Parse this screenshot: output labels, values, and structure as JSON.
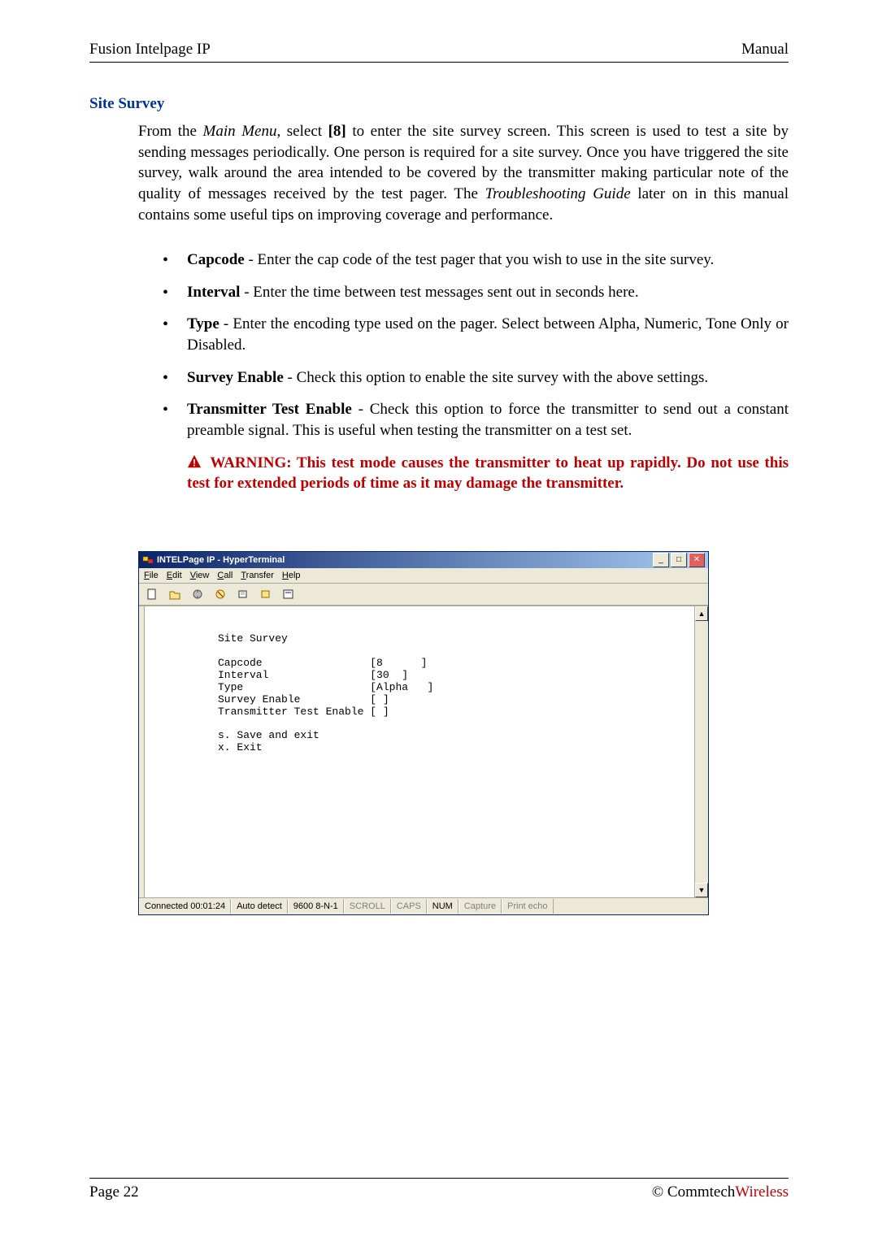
{
  "header": {
    "left": "Fusion Intelpage IP",
    "right": "Manual"
  },
  "section": {
    "title": "Site Survey",
    "intro_parts": {
      "pre_italic1": "From the ",
      "italic1": "Main Menu",
      "mid1": ", select ",
      "bold1": "[8]",
      "mid2": " to enter the site survey screen. This screen is used to test a site by sending messages periodically. One person is required for a site survey. Once you have triggered the site survey, walk around the area intended to be covered by the transmitter making particular note of the quality of messages received by the test pager. The ",
      "italic2": "Troubleshooting Guide",
      "tail": " later on in this manual contains some useful tips on improving coverage and performance."
    },
    "bullets": [
      {
        "label": "Capcode",
        "text": " - Enter the cap code of the test pager that you wish to use in the site survey."
      },
      {
        "label": "Interval",
        "text": "  - Enter the time between test messages sent out in seconds here."
      },
      {
        "label": "Type",
        "text": " - Enter the encoding type used on the pager. Select between Alpha, Numeric, Tone Only or Disabled."
      },
      {
        "label": "Survey Enable",
        "text": " - Check this option to enable the site survey with the above settings."
      },
      {
        "label": "Transmitter Test Enable",
        "text": " - Check this option to force the transmitter to send out a constant preamble signal. This is useful when testing the transmitter on a test set."
      }
    ],
    "warning": " WARNING: This test mode causes the transmitter to heat up rapidly. Do not use this test for extended periods of time as it may damage the transmitter."
  },
  "hyperterminal": {
    "title": "INTELPage IP - HyperTerminal",
    "menus": [
      "File",
      "Edit",
      "View",
      "Call",
      "Transfer",
      "Help"
    ],
    "terminal_title": "Site Survey",
    "fields": {
      "Capcode": "[8      ]",
      "Interval": "[30  ]",
      "Type": "[Alpha   ]",
      "Survey Enable": "[ ]",
      "Transmitter Test Enable": "[ ]"
    },
    "options": [
      "s. Save and exit",
      "x. Exit"
    ],
    "status": {
      "connected": "Connected 00:01:24",
      "detect": "Auto detect",
      "baud": "9600 8-N-1",
      "scroll": "SCROLL",
      "caps": "CAPS",
      "num": "NUM",
      "capture": "Capture",
      "printecho": "Print echo"
    }
  },
  "footer": {
    "page": "Page 22",
    "copyright": "© Commtech",
    "brand_suffix": "Wireless"
  }
}
